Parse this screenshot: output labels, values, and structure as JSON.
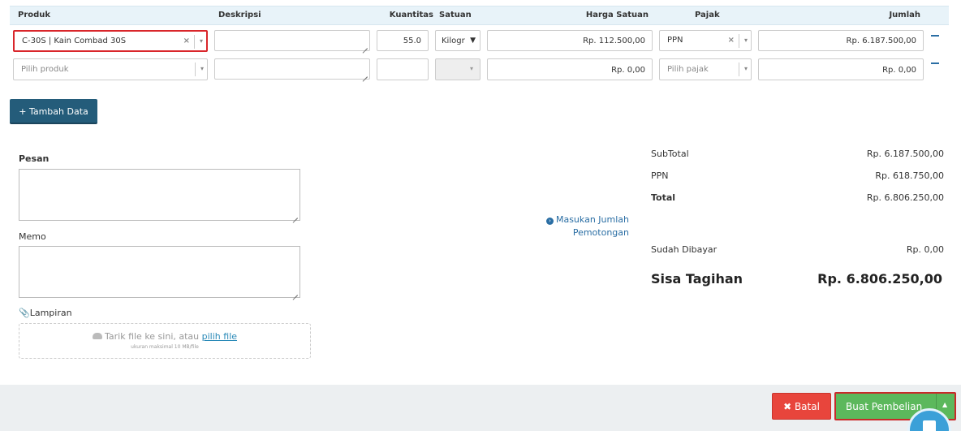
{
  "table": {
    "headers": {
      "produk": "Produk",
      "deskripsi": "Deskripsi",
      "kuantitas": "Kuantitas",
      "satuan": "Satuan",
      "harga_satuan": "Harga Satuan",
      "pajak": "Pajak",
      "jumlah": "Jumlah"
    },
    "rows": [
      {
        "produk": "C-30S | Kain Combad 30S",
        "deskripsi": "",
        "kuantitas": "55.0",
        "satuan": "Kilogr",
        "harga_satuan": "Rp. 112.500,00",
        "pajak": "PPN",
        "jumlah": "Rp. 6.187.500,00"
      },
      {
        "produk_placeholder": "Pilih produk",
        "deskripsi": "",
        "kuantitas": "",
        "satuan": "",
        "harga_satuan": "Rp. 0,00",
        "pajak_placeholder": "Pilih pajak",
        "jumlah": "Rp. 0,00"
      }
    ],
    "clear_glyph": "×",
    "dropdown_glyph": "▾",
    "satuan_arrow": "▼"
  },
  "tambah_label": "+ Tambah Data",
  "pesan_label": "Pesan",
  "memo_label": "Memo",
  "lampiran_label": "Lampiran",
  "lampiran_icon": "paperclip-icon",
  "dropzone": {
    "text": "Tarik file ke sini, atau ",
    "link": "pilih file",
    "subtext": "ukuran maksimal 10 MB/file"
  },
  "potongan": {
    "line1": "Masukan Jumlah",
    "line2": "Pemotongan"
  },
  "summary": {
    "subtotal_label": "SubTotal",
    "subtotal_value": "Rp. 6.187.500,00",
    "ppn_label": "PPN",
    "ppn_value": "Rp. 618.750,00",
    "total_label": "Total",
    "total_value": "Rp. 6.806.250,00",
    "sudah_dibayar_label": "Sudah Dibayar",
    "sudah_dibayar_value": "Rp. 0,00",
    "sisa_label": "Sisa Tagihan",
    "sisa_value": "Rp. 6.806.250,00"
  },
  "footer": {
    "batal_label": "Batal",
    "buat_label": "Buat Pembelian",
    "caret_glyph": "▲"
  },
  "colors": {
    "accent_blue": "#245c7a",
    "link_blue": "#2a6ea4",
    "danger_red": "#e8453c",
    "success_green": "#5cb85c"
  }
}
